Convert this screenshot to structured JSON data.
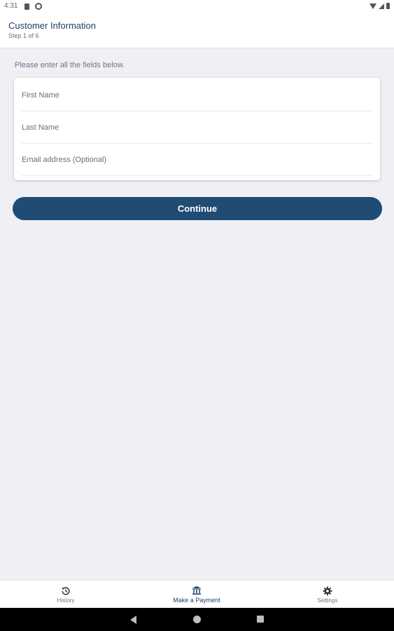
{
  "status_bar": {
    "time": "4:31"
  },
  "header": {
    "title": "Customer Information",
    "subtitle": "Step 1 of 6"
  },
  "form": {
    "instructions": "Please enter all the fields below.",
    "fields": [
      {
        "placeholder": "First Name",
        "value": ""
      },
      {
        "placeholder": "Last Name",
        "value": ""
      },
      {
        "placeholder": "Email address (Optional)",
        "value": ""
      }
    ],
    "continue_label": "Continue"
  },
  "bottom_nav": {
    "items": [
      {
        "label": "History",
        "icon": "history-icon"
      },
      {
        "label": "Make a Payment",
        "icon": "bank-icon",
        "active": true
      },
      {
        "label": "Settings",
        "icon": "gear-icon"
      }
    ]
  },
  "colors": {
    "brand": "#204b73",
    "header_text": "#1f3f66",
    "background": "#efeff4"
  }
}
